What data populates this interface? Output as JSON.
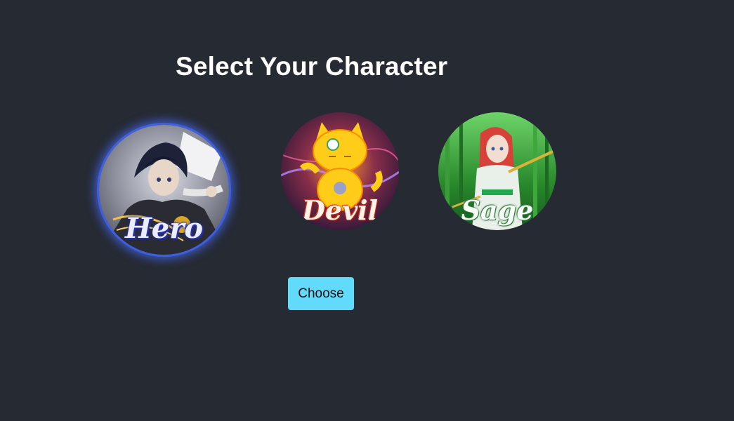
{
  "page": {
    "title": "Select Your Character"
  },
  "characters": [
    {
      "label": "Hero",
      "selected": true,
      "theme_color": "#3f5fe0"
    },
    {
      "label": "Devil",
      "selected": false,
      "theme_color": "#ffcc00"
    },
    {
      "label": "Sage",
      "selected": false,
      "theme_color": "#2e9a3c"
    }
  ],
  "actions": {
    "choose_label": "Choose"
  },
  "colors": {
    "background": "#262a33",
    "button": "#61dafb",
    "selection_glow": "#3f5fe0"
  }
}
